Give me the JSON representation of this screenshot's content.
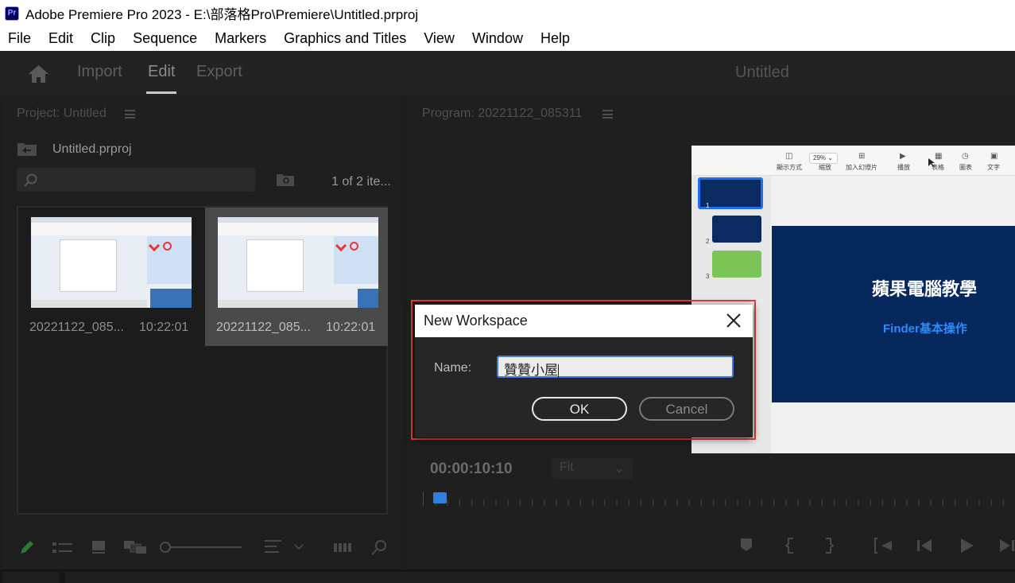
{
  "window": {
    "app_icon": "Pr",
    "title": "Adobe Premiere Pro 2023 - E:\\部落格Pro\\Premiere\\Untitled.prproj"
  },
  "menu": [
    "File",
    "Edit",
    "Clip",
    "Sequence",
    "Markers",
    "Graphics and Titles",
    "View",
    "Window",
    "Help"
  ],
  "nav": {
    "home_icon": "home-icon",
    "tabs": [
      "Import",
      "Edit",
      "Export"
    ],
    "active_tab": "Edit",
    "document_title": "Untitled"
  },
  "project": {
    "panel_title": "Project: Untitled",
    "file_name": "Untitled.prproj",
    "item_count": "1 of 2 ite...",
    "search_placeholder": "",
    "clips": [
      {
        "name": "20221122_085...",
        "duration": "10:22:01",
        "selected": false
      },
      {
        "name": "20221122_085...",
        "duration": "10:22:01",
        "selected": true
      }
    ]
  },
  "program": {
    "panel_title": "Program: 20221122_085311",
    "timecode": "00:00:10:10",
    "fit": "Fit",
    "slide": {
      "zoom": "29%",
      "toolbar": [
        "顯示方式",
        "縮放",
        "加入幻燈片",
        "播放",
        "表格",
        "圖表",
        "文字"
      ],
      "title": "蘋果電腦教學",
      "subtitle": "Finder基本操作",
      "slide_numbers": [
        "1",
        "2",
        "3"
      ]
    }
  },
  "dialog": {
    "title": "New Workspace",
    "name_label": "Name:",
    "name_value": "贊贊小屋",
    "ok": "OK",
    "cancel": "Cancel",
    "highlight_color": "#e03c3c"
  },
  "colors": {
    "accent": "#2d7fe0"
  }
}
